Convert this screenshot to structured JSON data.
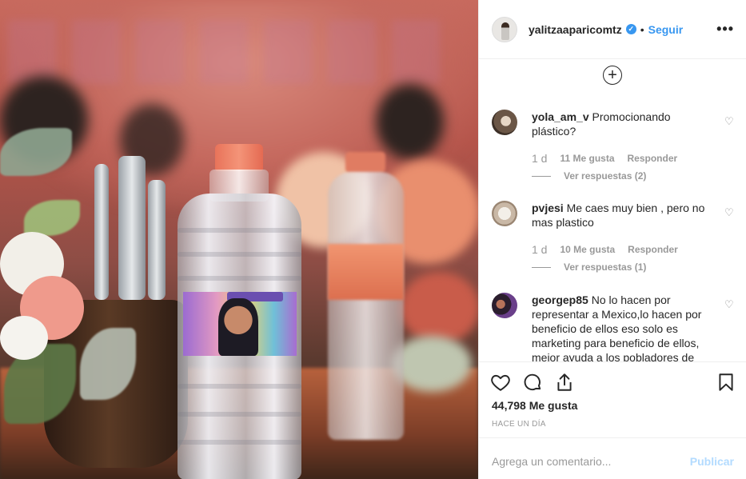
{
  "post": {
    "username": "yalitzaaparicomtz",
    "follow_label": "Seguir",
    "separator": "•",
    "more_icon": "•••",
    "load_more_icon": "+"
  },
  "comments": [
    {
      "username": "yola_am_v",
      "text": "Promocionando plástico?",
      "time": "1 d",
      "likes": "11 Me gusta",
      "reply": "Responder",
      "replies": "Ver respuestas (2)"
    },
    {
      "username": "pvjesi",
      "text": "Me caes muy bien , pero no mas plastico",
      "time": "1 d",
      "likes": "10 Me gusta",
      "reply": "Responder",
      "replies": "Ver respuestas (1)"
    },
    {
      "username": "georgep85",
      "text": "No lo hacen por representar a Mexico,lo hacen por beneficio de ellos eso solo es marketing para beneficio de ellos, mejor ayuda a los pobladores de"
    }
  ],
  "footer": {
    "likes_count": "44,798 Me gusta",
    "posted": "HACE UN DÍA",
    "comment_placeholder": "Agrega un comentario...",
    "publish_label": "Publicar"
  },
  "colors": {
    "accent": "#3897f0",
    "muted": "#999999",
    "publish_disabled": "#b3dbff"
  }
}
